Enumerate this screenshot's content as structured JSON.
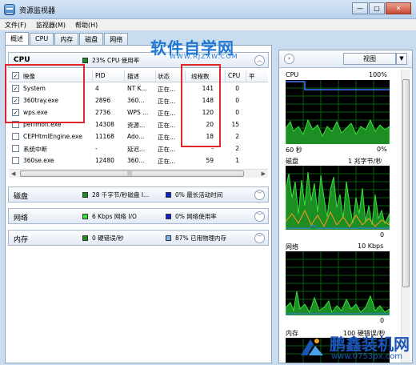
{
  "window": {
    "title": "资源监视器",
    "buttons": {
      "minimize": "—",
      "maximize": "□",
      "close": "✕"
    }
  },
  "menu": [
    "文件(F)",
    "监视器(M)",
    "帮助(H)"
  ],
  "tabs": [
    "概述",
    "CPU",
    "内存",
    "磁盘",
    "网络"
  ],
  "cpu": {
    "title": "CPU",
    "stat1": "23% CPU 使用率",
    "columns": [
      "映像",
      "PID",
      "描述",
      "状态",
      "线程数",
      "CPU",
      "平"
    ],
    "rows": [
      {
        "checked": true,
        "name": "System",
        "pid": "4",
        "desc": "NT K...",
        "status": "正在...",
        "threads": "141",
        "cpu": "0"
      },
      {
        "checked": true,
        "name": "360tray.exe",
        "pid": "2896",
        "desc": "360...",
        "status": "正在...",
        "threads": "148",
        "cpu": "0"
      },
      {
        "checked": true,
        "name": "wps.exe",
        "pid": "2736",
        "desc": "WPS ...",
        "status": "正在...",
        "threads": "120",
        "cpu": "0"
      },
      {
        "checked": false,
        "name": "perfmon.exe",
        "pid": "14308",
        "desc": "资源...",
        "status": "正在...",
        "threads": "20",
        "cpu": "15"
      },
      {
        "checked": false,
        "name": "CEPHtmlEngine.exe",
        "pid": "11168",
        "desc": "Ado...",
        "status": "正在...",
        "threads": "18",
        "cpu": "2"
      },
      {
        "checked": false,
        "name": "系统中断",
        "pid": "-",
        "desc": "延迟...",
        "status": "正在...",
        "threads": "-",
        "cpu": "2"
      },
      {
        "checked": false,
        "name": "360se.exe",
        "pid": "12480",
        "desc": "360...",
        "status": "正在...",
        "threads": "59",
        "cpu": "1"
      }
    ]
  },
  "disk": {
    "title": "磁盘",
    "stat1": "28 千字节/秒磁盘 I...",
    "stat2": "0% 最长活动时间"
  },
  "network": {
    "title": "网络",
    "stat1": "6 Kbps 网络 I/O",
    "stat2": "0% 网络使用率"
  },
  "memory": {
    "title": "内存",
    "stat1": "0 硬错误/秒",
    "stat2": "87% 已用物理内存"
  },
  "right": {
    "view_label": "视图",
    "cpu_graph": {
      "title": "CPU",
      "max": "100%",
      "time": "60 秒",
      "min": "0%"
    },
    "disk_graph": {
      "title": "磁盘",
      "max": "1 兆字节/秒",
      "min": "0"
    },
    "net_graph": {
      "title": "网络",
      "max": "10 Kbps",
      "min": "0"
    },
    "mem_graph": {
      "title": "内存",
      "max": "100 硬错误/秒"
    }
  },
  "watermark": {
    "top": "软件自学网",
    "top_sub": "WWW.RJZXW.COM",
    "bottom": "鹏鑫装机网",
    "bottom_sub": "www.0753px.com"
  },
  "colors": {
    "cpu_green": "#1d8e23",
    "net_bright": "#38e03a",
    "blue": "#1020c8",
    "highlight_red": "#e0262b",
    "graph_line_blue": "#3c78ff"
  }
}
